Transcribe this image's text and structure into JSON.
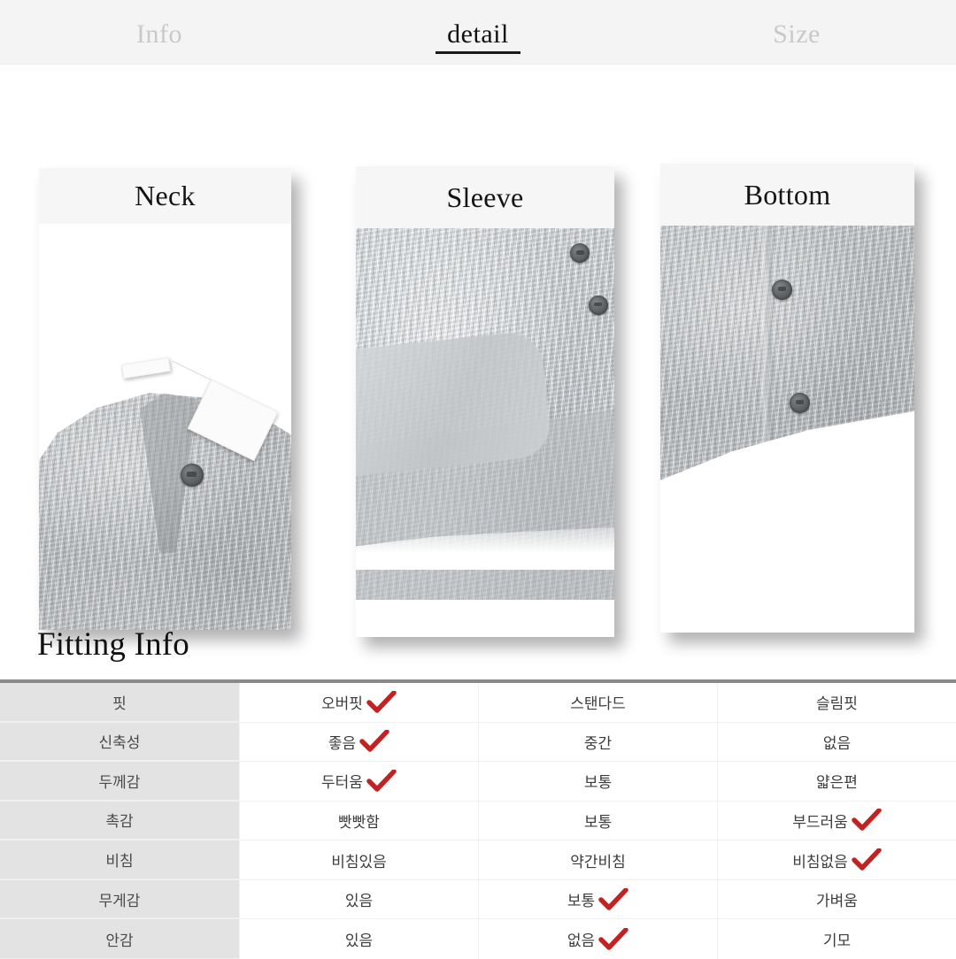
{
  "tabs": [
    {
      "label": "Info",
      "active": false
    },
    {
      "label": "detail",
      "active": true
    },
    {
      "label": "Size",
      "active": false
    }
  ],
  "gallery": {
    "panels": [
      {
        "title": "Neck"
      },
      {
        "title": "Sleeve"
      },
      {
        "title": "Bottom"
      }
    ]
  },
  "fitting": {
    "title": "Fitting Info",
    "check_color": "#c32222",
    "rows": [
      {
        "label": "핏",
        "options": [
          {
            "text": "오버핏",
            "checked": true
          },
          {
            "text": "스탠다드",
            "checked": false
          },
          {
            "text": "슬림핏",
            "checked": false
          }
        ]
      },
      {
        "label": "신축성",
        "options": [
          {
            "text": "좋음",
            "checked": true
          },
          {
            "text": "중간",
            "checked": false
          },
          {
            "text": "없음",
            "checked": false
          }
        ]
      },
      {
        "label": "두께감",
        "options": [
          {
            "text": "두터움",
            "checked": true
          },
          {
            "text": "보통",
            "checked": false
          },
          {
            "text": "얇은편",
            "checked": false
          }
        ]
      },
      {
        "label": "촉감",
        "options": [
          {
            "text": "빳빳함",
            "checked": false
          },
          {
            "text": "보통",
            "checked": false
          },
          {
            "text": "부드러움",
            "checked": true
          }
        ]
      },
      {
        "label": "비침",
        "options": [
          {
            "text": "비침있음",
            "checked": false
          },
          {
            "text": "약간비침",
            "checked": false
          },
          {
            "text": "비침없음",
            "checked": true
          }
        ]
      },
      {
        "label": "무게감",
        "options": [
          {
            "text": "있음",
            "checked": false
          },
          {
            "text": "보통",
            "checked": true
          },
          {
            "text": "가벼움",
            "checked": false
          }
        ]
      },
      {
        "label": "안감",
        "options": [
          {
            "text": "있음",
            "checked": false
          },
          {
            "text": "없음",
            "checked": true
          },
          {
            "text": "기모",
            "checked": false
          }
        ]
      }
    ]
  }
}
